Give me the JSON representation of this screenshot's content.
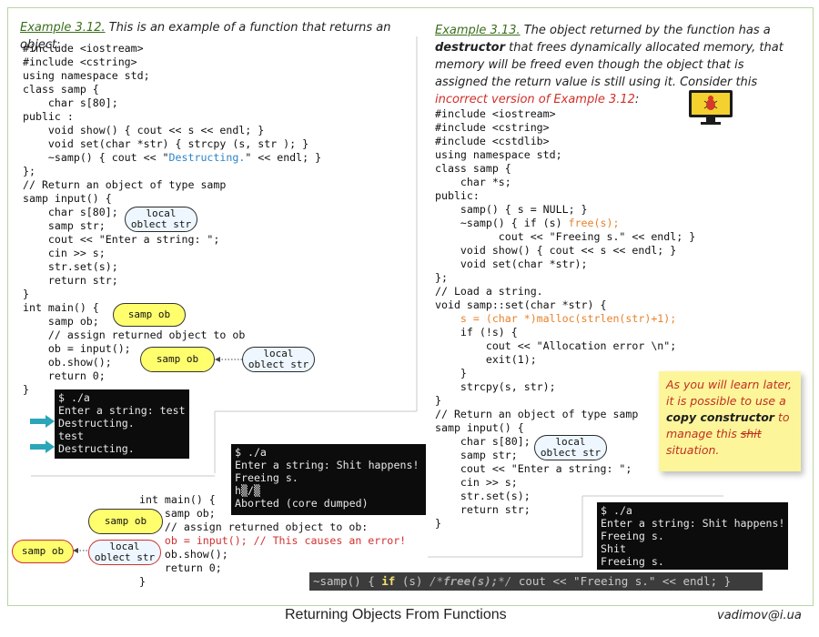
{
  "left_caption": {
    "example": "Example 3.12.",
    "text": " This  is an example of a function that returns an object:"
  },
  "left_code": "#include <iostream>\n#include <cstring>\nusing namespace std;\nclass samp {\n    char s[80];\npublic :\n    void show() { cout << s << endl; }\n    void set(char *str) { strcpy (s, str ); }\n    ~samp() { cout << \"",
  "left_code_destructing": "Destructing.",
  "left_code_tail": "\" << endl; }\n};\n// Return an object of type samp\nsamp input() {\n    char s[80];\n    samp str;\n    cout << \"Enter a string: \";\n    cin >> s;\n    str.set(s);\n    return str;\n}\nint main() {\n    samp ob;\n    // assign returned object to ob\n    ob = input();\n    ob.show();\n    return 0;\n}",
  "bubbles": {
    "local": "local\noblect str",
    "samp": "samp ob"
  },
  "terminal1": "$ ./a\nEnter a string: test\nDestructing.\ntest\nDestructing.",
  "right_caption": {
    "example": "Example 3.13.",
    "t1": " The object returned by the function has a ",
    "bold": "destructor",
    "t2": " that frees dynamically allocated memory, that memory will be freed even though the object that is assigned the return value is still using it. Consider this ",
    "red": "incorrect version of Example 3.12",
    "t3": ":"
  },
  "right_code_a": "#include <iostream>\n#include <cstring>\n#include <cstdlib>\nusing namespace std;\nclass samp {\n    char *s;\npublic:\n    samp() { s = NULL; }\n    ~samp() { if (s) ",
  "right_code_free": "free(s);",
  "right_code_b": "\n          cout << \"Freeing s.\" << endl; }\n    void show() { cout << s << endl; }\n    void set(char *str);\n};\n// Load a string.\nvoid samp::set(char *str) {\n    ",
  "right_code_malloc": "s = (char *)malloc(strlen(str)+1);",
  "right_code_c": "\n    if (!s) {\n        cout << \"Allocation error \\n\";\n        exit(1);\n    }\n    strcpy(s, str);\n}\n// Return an object of type samp\nsamp input() {\n    char s[80];\n    samp str;\n    cout << \"Enter a string: \";\n    cin >> s;\n    str.set(s);\n    return str;\n}",
  "terminal2": "$ ./a\nEnter a string: Shit happens!\nFreeing s.\nh▒/▒\nAborted (core dumped)",
  "terminal3": "$ ./a\nEnter a string: Shit happens!\nFreeing s.\nShit\nFreeing s.",
  "bottom_code_a": "int main() {\n    samp ob;\n    // assign returned object to ob:\n    ",
  "bottom_code_red": "ob = input(); // This causes an error!",
  "bottom_code_b": "\n    ob.show();\n    return 0;\n}",
  "note": {
    "t1": "As you will learn later, it is possible to use a ",
    "bold": "copy constructor",
    "t2": " to manage this ",
    "strike": "shit",
    "t3": " situation."
  },
  "darkbar": {
    "p1": "~samp() { ",
    "kw": "if",
    "p2": " (s) ",
    "cm1": "/*",
    "cm2": "free(s);",
    "cm3": "*/",
    "p3": " cout << ",
    "str": "\"Freeing s.\"",
    "p4": " << endl; }"
  },
  "footer": "Returning Objects From Functions",
  "email": "vadimov@i.ua",
  "icons": {
    "bug": "bug-monitor-icon",
    "arrow": "teal-arrow-icon"
  },
  "colors": {
    "accent_green": "#3a6f1c",
    "code_blue": "#2c83c9",
    "code_orange": "#e8822a",
    "error_red": "#d33030",
    "note_yellow": "#fdf59a"
  }
}
